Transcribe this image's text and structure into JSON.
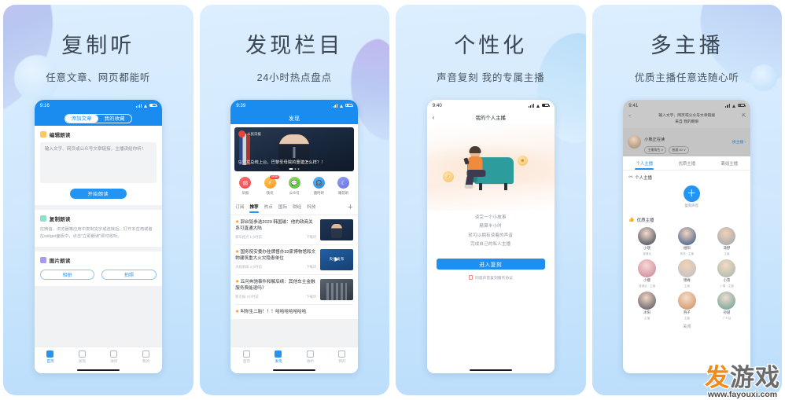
{
  "panels": [
    {
      "title": "复制听",
      "subtitle": "任意文章、网页都能听",
      "phone": {
        "status_time": "9:16",
        "segments": [
          "添加文章",
          "我的收藏"
        ],
        "cards": [
          {
            "title": "编辑朗读",
            "placeholder": "输入文字、网页或公众号文章链接，主播读给你听！",
            "button": "开始朗读"
          },
          {
            "title": "复制朗读",
            "desc": "在微信、浏览器等应用中复制文字或连接后，打开本应用或者在widget面板中，点击\"立即朗读\"即可收听。"
          },
          {
            "title": "图片朗读",
            "buttons": [
              "相册",
              "拍照"
            ]
          }
        ],
        "tabs": [
          {
            "label": "首页",
            "active": true
          },
          {
            "label": "发现",
            "active": false
          },
          {
            "label": "收听",
            "active": false
          },
          {
            "label": "我的",
            "active": false
          }
        ]
      }
    },
    {
      "title": "发现栏目",
      "subtitle": "24小时热点盘点",
      "phone": {
        "status_time": "9:39",
        "nav_title": "发现",
        "hero": {
          "source": "人民日报",
          "caption": "马克龙总统上台，巴黎圣母院的重建怎么样？！"
        },
        "quick": [
          {
            "label": "早报",
            "icon": "newspaper-icon",
            "badge": ""
          },
          {
            "label": "快讯",
            "icon": "lightning-icon",
            "badge": "NEW"
          },
          {
            "label": "公众号",
            "icon": "chat-icon",
            "badge": ""
          },
          {
            "label": "随时听",
            "icon": "headphone-icon",
            "badge": ""
          },
          {
            "label": "睡前听",
            "icon": "moon-icon",
            "badge": ""
          }
        ],
        "chips": [
          "订阅",
          "推荐",
          "热点",
          "国际",
          "财经",
          "科技"
        ],
        "chip_active": "推荐",
        "news": [
          {
            "headline": "郭台铭参选2020 韩国瑜：他的政商关系可直通大陆",
            "source": "新华视点",
            "time": "1小时前",
            "action": "下载听"
          },
          {
            "headline": "国务院安委办挂牌督办33家博物馆和文物建筑重大火灾隐患单位",
            "source": "央视新闻",
            "time": "2小时前",
            "action": "下载听"
          },
          {
            "headline": "五问奔驰事件和解后续：其他车主金融服务费能退吗？",
            "source": "新京报",
            "time": "3小时前",
            "action": "下载听"
          },
          {
            "headline": "叫你生二胎！！！哈哈哈哈哈哈哈",
            "source": "",
            "time": "",
            "action": ""
          }
        ],
        "tabs": [
          {
            "label": "首页",
            "active": false
          },
          {
            "label": "发现",
            "active": true
          },
          {
            "label": "收听",
            "active": false
          },
          {
            "label": "我的",
            "active": false
          }
        ]
      }
    },
    {
      "title": "个性化",
      "subtitle": "声音复刻 我的专属主播",
      "phone": {
        "status_time": "9:40",
        "nav_title": "我的个人主播",
        "lines": [
          "读完一个小故事",
          "精算半小时",
          "就可以拥有读着的声音",
          "完成自己的私人主播"
        ],
        "cta": "进入复刻",
        "agreement": "同意声音复刻服务协议"
      }
    },
    {
      "title": "多主播",
      "subtitle": "优质主播任意选随心听",
      "phone": {
        "status_time": "9:41",
        "header_text": "输入文字、网页或公众号文章链接\n来自 我的朗单",
        "user_name": "小熊正在读",
        "user_pills": [
          "主播角色 ∨",
          "普通 60 ∨"
        ],
        "user_more": "换主播 ›",
        "tabs": [
          "个人主播",
          "优质主播",
          "离线主播"
        ],
        "tab_active": "个人主播",
        "section_personal": "个人主播",
        "add_label": "复刻声音",
        "section_quality": "优质主播",
        "anchors": [
          {
            "name": "小晓",
            "sub": "普通话"
          },
          {
            "name": "相阳",
            "sub": "粤语 · 主播"
          },
          {
            "name": "潇野",
            "sub": "主播"
          },
          {
            "name": "小樱",
            "sub": "普通话 · 主播"
          },
          {
            "name": "锦峰",
            "sub": "主播"
          },
          {
            "name": "小雪",
            "sub": "小雪 · 主播"
          },
          {
            "name": "冰阳",
            "sub": "主播"
          },
          {
            "name": "燕子",
            "sub": "主播"
          },
          {
            "name": "孙越",
            "sub": "广东话"
          }
        ],
        "close_label": "关闭"
      }
    }
  ],
  "watermark": {
    "char_orange": "发",
    "char_grey": "游戏",
    "url": "www.fayouxi.com"
  }
}
